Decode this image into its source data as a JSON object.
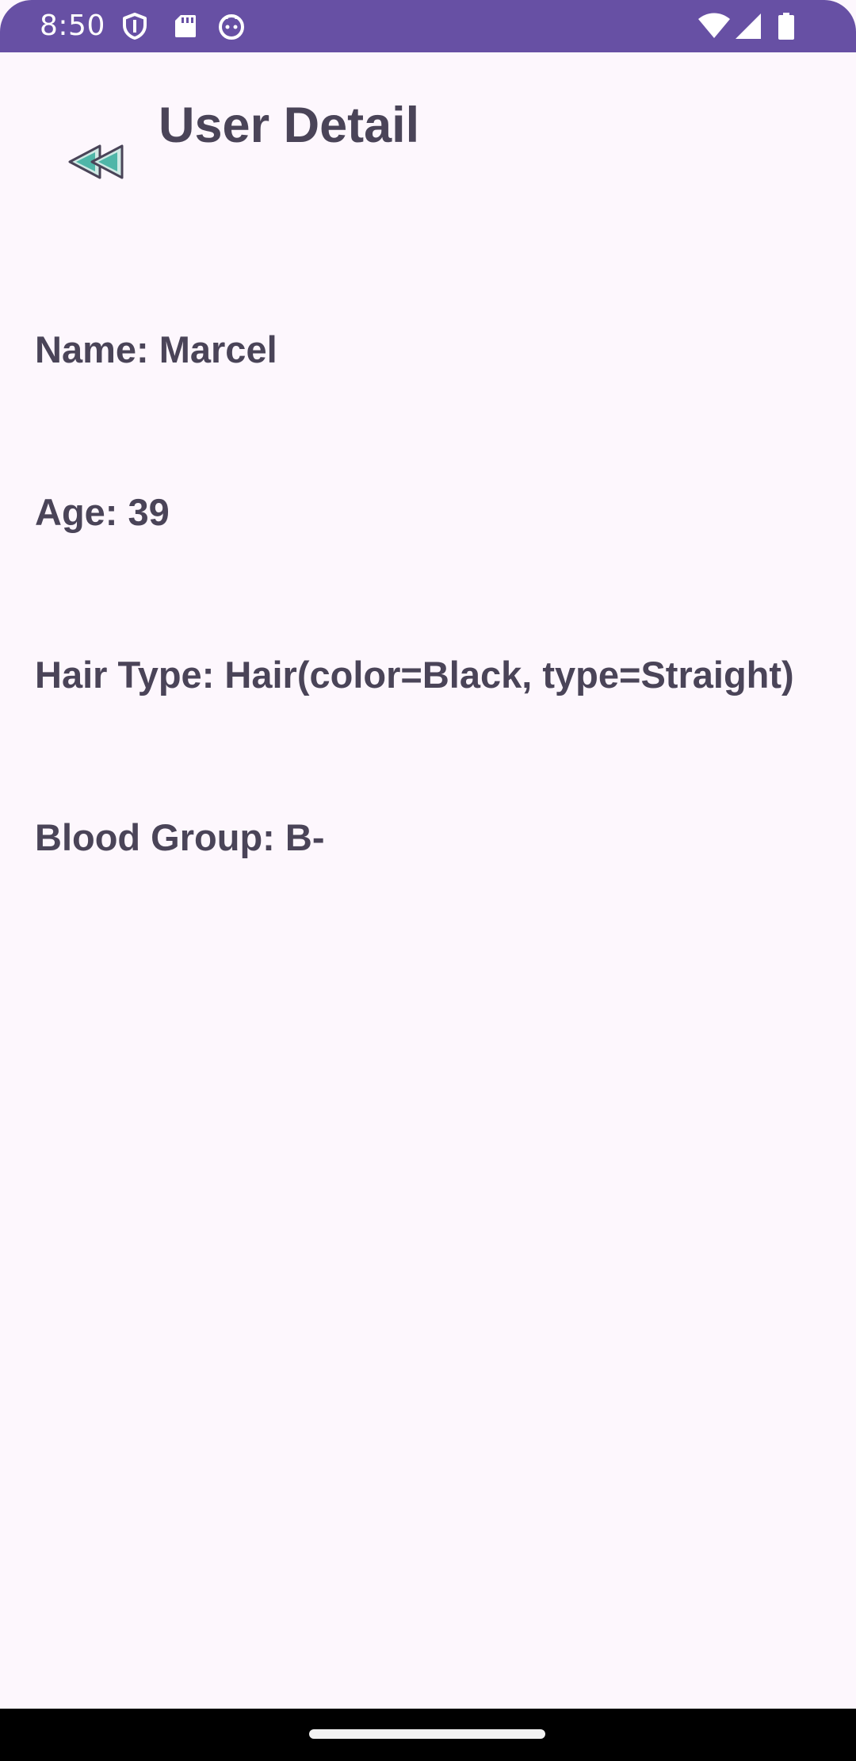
{
  "status_bar": {
    "time": "8:50",
    "left_icons": [
      "shield-icon",
      "sd-card-icon",
      "cat-face-icon"
    ],
    "right_icons": [
      "wifi-icon",
      "cell-signal-icon",
      "battery-icon"
    ],
    "color": "#6750a4"
  },
  "header": {
    "title": "User Detail",
    "back_icon": "double-triangle-back-icon"
  },
  "details": {
    "name": "Name: Marcel",
    "age": "Age: 39",
    "hair_type": "Hair Type: Hair(color=Black, type=Straight)",
    "blood_group": "Blood Group: B-"
  },
  "colors": {
    "background": "#fdf7fd",
    "text": "#4a4458",
    "accent_teal": "#4fb6a8"
  }
}
